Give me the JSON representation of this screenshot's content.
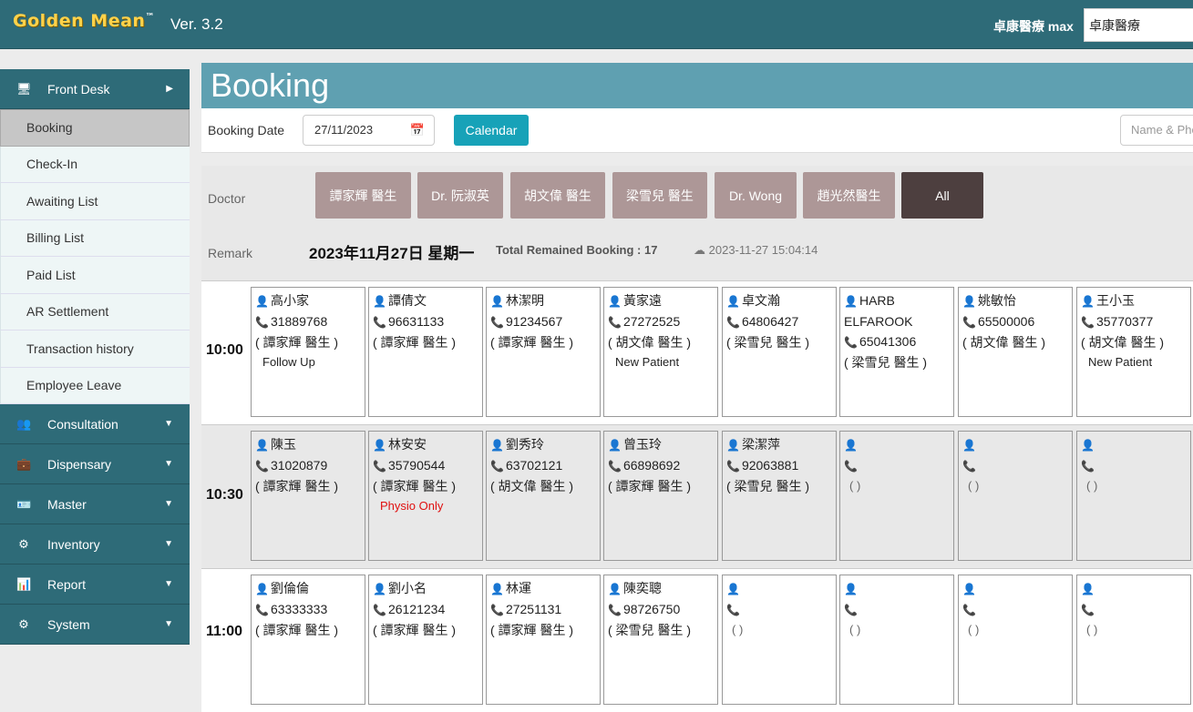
{
  "app": {
    "logo": "Golden Mean",
    "tm": "™",
    "version": "Ver. 3.2",
    "user": "卓康醫療 max",
    "clinic_value": "卓康醫療"
  },
  "sidebar": {
    "front_desk": "Front Desk",
    "sub_items": [
      "Booking",
      "Check-In",
      "Awaiting List",
      "Billing List",
      "Paid List",
      "AR Settlement",
      "Transaction history",
      "Employee Leave"
    ],
    "groups": [
      "Consultation",
      "Dispensary",
      "Master",
      "Inventory",
      "Report",
      "System"
    ]
  },
  "booking": {
    "title": "Booking",
    "date_label": "Booking Date",
    "date_value": "27/11/2023",
    "calendar_button": "Calendar",
    "search_placeholder": "Name & Phone",
    "doctor_label": "Doctor",
    "remark_label": "Remark",
    "doctors": [
      "譚家輝 醫生",
      "Dr. 阮淑英",
      "胡文偉 醫生",
      "梁雪兒 醫生",
      "Dr. Wong",
      "趙光然醫生",
      "All"
    ],
    "date_heading": "2023年11月27日 星期一",
    "remained": "Total Remained Booking : 17",
    "timestamp": "2023-11-27 15:04:14"
  },
  "slots": [
    {
      "time": "10:00",
      "cells": [
        {
          "name": "高小家",
          "phone": "31889768",
          "doctor": "( 譚家輝 醫生 )",
          "note": "Follow Up"
        },
        {
          "name": "譚倩文",
          "phone": "96631133",
          "doctor": "( 譚家輝 醫生 )",
          "note": ""
        },
        {
          "name": "林潔明",
          "phone": "91234567",
          "doctor": "( 譚家輝 醫生 )",
          "note": ""
        },
        {
          "name": "黃家遠",
          "phone": "27272525",
          "doctor": "( 胡文偉 醫生 )",
          "note": "New Patient"
        },
        {
          "name": "卓文瀚",
          "phone": "64806427",
          "doctor": "( 梁雪兒 醫生 )",
          "note": ""
        },
        {
          "name": "HARB ELFAROOK",
          "phone": "65041306",
          "doctor": "( 梁雪兒 醫生 )",
          "note": ""
        },
        {
          "name": "姚敏怡",
          "phone": "65500006",
          "doctor": "( 胡文偉 醫生 )",
          "note": ""
        },
        {
          "name": "王小玉",
          "phone": "35770377",
          "doctor": "( 胡文偉 醫生 )",
          "note": "New Patient"
        }
      ]
    },
    {
      "time": "10:30",
      "cells": [
        {
          "name": "陳玉",
          "phone": "31020879",
          "doctor": "( 譚家輝 醫生 )",
          "note": ""
        },
        {
          "name": "林安安",
          "phone": "35790544",
          "doctor": "( 譚家輝 醫生 )",
          "note": "Physio Only",
          "red": true
        },
        {
          "name": "劉秀玲",
          "phone": "63702121",
          "doctor": "( 胡文偉 醫生 )",
          "note": ""
        },
        {
          "name": "曾玉玲",
          "phone": "66898692",
          "doctor": "( 譚家輝 醫生 )",
          "note": ""
        },
        {
          "name": "梁潔萍",
          "phone": "92063881",
          "doctor": "( 梁雪兒 醫生 )",
          "note": ""
        },
        {
          "empty": true,
          "doctor": "( )"
        },
        {
          "empty": true,
          "doctor": "( )"
        },
        {
          "empty": true,
          "doctor": "( )"
        }
      ]
    },
    {
      "time": "11:00",
      "cells": [
        {
          "name": "劉倫倫",
          "phone": "63333333",
          "doctor": "( 譚家輝 醫生 )",
          "note": ""
        },
        {
          "name": "劉小名",
          "phone": "26121234",
          "doctor": "( 譚家輝 醫生 )",
          "note": ""
        },
        {
          "name": "林運",
          "phone": "27251131",
          "doctor": "( 譚家輝 醫生 )",
          "note": ""
        },
        {
          "name": "陳奕聰",
          "phone": "98726750",
          "doctor": "( 梁雪兒 醫生 )",
          "note": ""
        },
        {
          "empty": true,
          "doctor": "( )"
        },
        {
          "empty": true,
          "doctor": "( )"
        },
        {
          "empty": true,
          "doctor": "( )"
        },
        {
          "empty": true,
          "doctor": "( )"
        }
      ]
    }
  ]
}
